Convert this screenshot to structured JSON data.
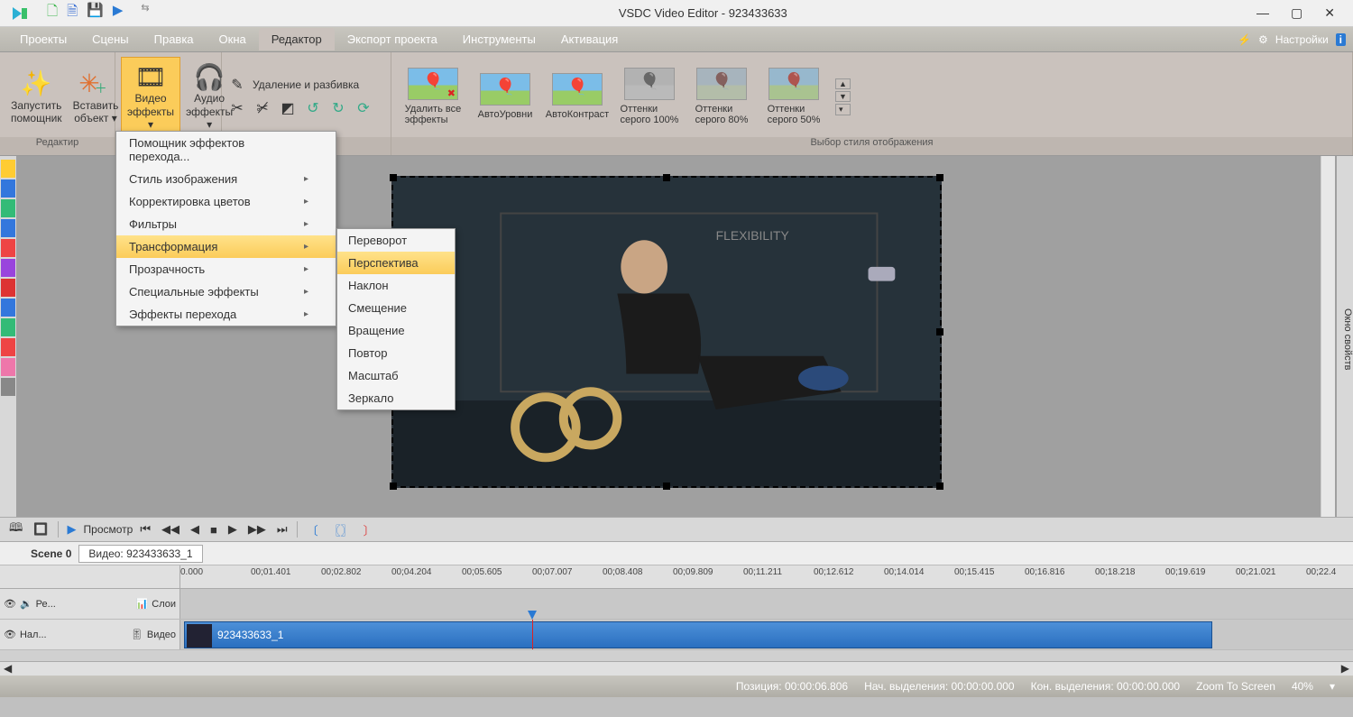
{
  "app": {
    "title": "VSDC Video Editor - 923433633"
  },
  "menu": {
    "tabs": [
      "Проекты",
      "Сцены",
      "Правка",
      "Окна",
      "Редактор",
      "Экспорт проекта",
      "Инструменты",
      "Активация"
    ],
    "active_index": 4,
    "settings": "Настройки"
  },
  "ribbon": {
    "g1_label": "Редактир",
    "g3_label": "Выбор стиля отображения",
    "run_wizard": "Запустить\nпомощник",
    "insert_obj": "Вставить\nобъект ▾",
    "video_fx": "Видео\nэффекты ▾",
    "audio_fx": "Аудио\nэффекты ▾",
    "del_split": "Удаление и разбивка",
    "styles": [
      {
        "label": "Удалить все\nэффекты",
        "cls": "del"
      },
      {
        "label": "АвтоУровни"
      },
      {
        "label": "АвтоКонтраст"
      },
      {
        "label": "Оттенки\nсерого 100%"
      },
      {
        "label": "Оттенки\nсерого 80%"
      },
      {
        "label": "Оттенки\nсерого 50%"
      }
    ]
  },
  "dropdown1": {
    "items": [
      {
        "label": "Помощник эффектов перехода...",
        "arrow": false
      },
      {
        "label": "Стиль изображения",
        "arrow": true
      },
      {
        "label": "Корректировка цветов",
        "arrow": true
      },
      {
        "label": "Фильтры",
        "arrow": true
      },
      {
        "label": "Трансформация",
        "arrow": true,
        "sel": true
      },
      {
        "label": "Прозрачность",
        "arrow": true
      },
      {
        "label": "Специальные эффекты",
        "arrow": true
      },
      {
        "label": "Эффекты перехода",
        "arrow": true
      }
    ]
  },
  "dropdown2": {
    "items": [
      {
        "label": "Переворот"
      },
      {
        "label": "Перспектива",
        "sel": true
      },
      {
        "label": "Наклон"
      },
      {
        "label": "Смещение"
      },
      {
        "label": "Вращение"
      },
      {
        "label": "Повтор"
      },
      {
        "label": "Масштаб"
      },
      {
        "label": "Зеркало"
      }
    ]
  },
  "right_panel": "Окно свойств",
  "preview": {
    "label": "Просмотр"
  },
  "timeline": {
    "scene": "Scene 0",
    "video_label": "Видео: 923433633_1",
    "ticks": [
      "0.000",
      "00;01.401",
      "00;02.802",
      "00;04.204",
      "00;05.605",
      "00;07.007",
      "00;08.408",
      "00;09.809",
      "00;11.211",
      "00;12.612",
      "00;14.014",
      "00;15.415",
      "00;16.816",
      "00;18.218",
      "00;19.619",
      "00;21.021",
      "00;22.4"
    ],
    "track1_head": "Ре...",
    "track1_layers": "Слои",
    "track2_head": "Нал...",
    "track2_video": "Видео",
    "clip_name": "923433633_1"
  },
  "status": {
    "pos_lbl": "Позиция:",
    "pos_val": "00:00:06.806",
    "sel_start_lbl": "Нач. выделения:",
    "sel_start_val": "00:00:00.000",
    "sel_end_lbl": "Кон. выделения:",
    "sel_end_val": "00:00:00.000",
    "zoom": "Zoom To Screen",
    "zoom_pct": "40%"
  }
}
